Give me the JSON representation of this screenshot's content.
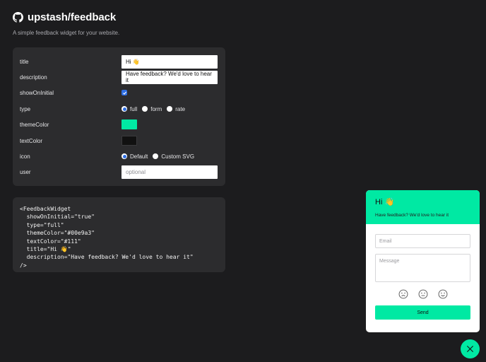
{
  "header": {
    "title": "upstash/feedback",
    "subtitle": "A simple feedback widget for your website."
  },
  "form": {
    "title": {
      "label": "title",
      "value": "Hi 👋"
    },
    "description": {
      "label": "description",
      "value": "Have feedback? We'd love to hear it"
    },
    "showOnInitial": {
      "label": "showOnInitial",
      "checked": true
    },
    "type": {
      "label": "type",
      "options": [
        "full",
        "form",
        "rate"
      ],
      "selected": "full"
    },
    "themeColor": {
      "label": "themeColor",
      "value": "#00e9a3"
    },
    "textColor": {
      "label": "textColor",
      "value": "#111"
    },
    "icon": {
      "label": "icon",
      "options": [
        "Default",
        "Custom SVG"
      ],
      "selected": "Default"
    },
    "user": {
      "label": "user",
      "placeholder": "optional"
    }
  },
  "code": {
    "snippet": "<FeedbackWidget\n  showOnInitial=\"true\"\n  type=\"full\"\n  themeColor=\"#00e9a3\"\n  textColor=\"#111\"\n  title=\"Hi 👋\"\n  description=\"Have feedback? We'd love to hear it\"\n/>"
  },
  "widget": {
    "title": "Hi 👋",
    "description": "Have feedback? We'd love to hear it",
    "email_placeholder": "Email",
    "message_placeholder": "Message",
    "rating_icons": [
      "sad-face-icon",
      "neutral-face-icon",
      "happy-face-icon"
    ],
    "send_label": "Send"
  },
  "colors": {
    "background": "#1c1c1e",
    "panel": "#2c2c2e",
    "accent": "#00e9a3",
    "checkbox": "#2f6fe4"
  }
}
